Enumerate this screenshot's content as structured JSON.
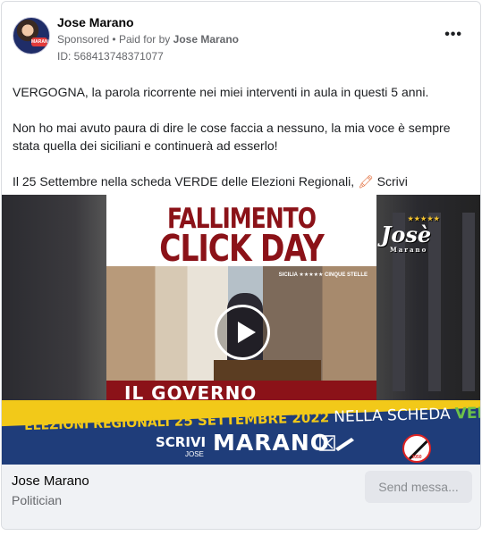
{
  "post": {
    "author": "Jose Marano",
    "sponsored_label": "Sponsored",
    "paid_prefix": "Paid for by",
    "payer": "Jose Marano",
    "ad_id": "ID: 568413748371077",
    "more_label": "•••",
    "avatar_badge": "MARANO"
  },
  "body": {
    "p1": "VERGOGNA, la parola ricorrente nei miei interventi in aula in questi 5 anni.",
    "p2": "Non ho mai avuto paura di dire le cose faccia a nessuno, la mia voce è sempre stata quella dei siciliani e continuerà ad esserlo!",
    "p3_before": "Il 25 Settembre nella scheda VERDE delle Elezioni Regionali,",
    "p3_emoji": "🖍",
    "p3_after": "Scrivi MARANO."
  },
  "media": {
    "poster_title_1": "FALLIMENTO",
    "poster_title_2": "CLICK DAY",
    "video_stripe": "IL GOVERNO MUSUMECI",
    "video_tag": "SICILIA ★★★★★ CINQUE STELLE",
    "logo_name": "Josè",
    "logo_stars": "★★★★★",
    "logo_sub": "Marano",
    "banner_line1_a": "ELEZIONI REGIONALI",
    "banner_line1_b": "25 SETTEMBRE 2022",
    "banner_line1_c": "NELLA SCHEDA",
    "banner_line1_d": "VERDE",
    "banner_scrivi": "SCRIVI",
    "banner_scrivi_sub": "JOSE",
    "banner_marano": "MARANO",
    "emblem_text": "2050"
  },
  "footer": {
    "page_name": "Jose Marano",
    "page_category": "Politician",
    "send_button": "Send messa..."
  },
  "colors": {
    "link_grey": "#65676b",
    "poster_red": "#8b1218",
    "banner_blue": "#1f3d7a",
    "banner_yellow": "#f2c919",
    "banner_green": "#6cc24a"
  }
}
